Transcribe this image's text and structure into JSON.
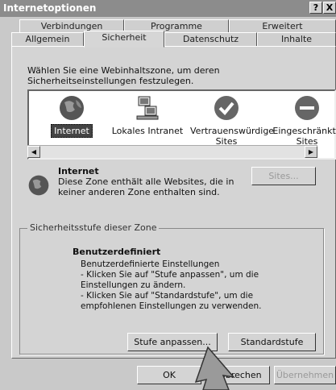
{
  "window": {
    "title": "Internetoptionen",
    "help_label": "?",
    "close_label": "X"
  },
  "tabs_back": [
    {
      "label": "Verbindungen"
    },
    {
      "label": "Programme"
    },
    {
      "label": "Erweitert"
    }
  ],
  "tabs_front": [
    {
      "label": "Allgemein"
    },
    {
      "label": "Sicherheit",
      "active": true
    },
    {
      "label": "Datenschutz"
    },
    {
      "label": "Inhalte"
    }
  ],
  "zone_prompt": "Wählen Sie eine Webinhaltszone, um deren Sicherheitseinstellungen festzulegen.",
  "zones": [
    {
      "label": "Internet",
      "icon": "globe-icon",
      "selected": true
    },
    {
      "label": "Lokales Intranet",
      "icon": "network-computers-icon"
    },
    {
      "label": "Vertrauenswürdige Sites",
      "icon": "checkmark-icon"
    },
    {
      "label": "Eingeschränkte Sites",
      "icon": "no-entry-icon"
    }
  ],
  "zone_info": {
    "title": "Internet",
    "description": "Diese Zone enthält alle Websites, die in keiner anderen Zone enthalten sind.",
    "sites_button": "Sites..."
  },
  "security": {
    "group_label": "Sicherheitsstufe dieser Zone",
    "level_title": "Benutzerdefiniert",
    "level_subtitle": "Benutzerdefinierte Einstellungen",
    "bullet1": "- Klicken Sie auf \"Stufe anpassen\", um die Einstellungen zu ändern.",
    "bullet2": "- Klicken Sie auf \"Standardstufe\", um die empfohlenen Einstellungen zu verwenden.",
    "custom_button": "Stufe anpassen...",
    "default_button": "Standardstufe"
  },
  "footer": {
    "ok": "OK",
    "cancel": "Abbrechen",
    "apply": "Übernehmen"
  },
  "colors": {
    "titlebar": "#8c8c8c",
    "dialog": "#d4d4d4"
  }
}
